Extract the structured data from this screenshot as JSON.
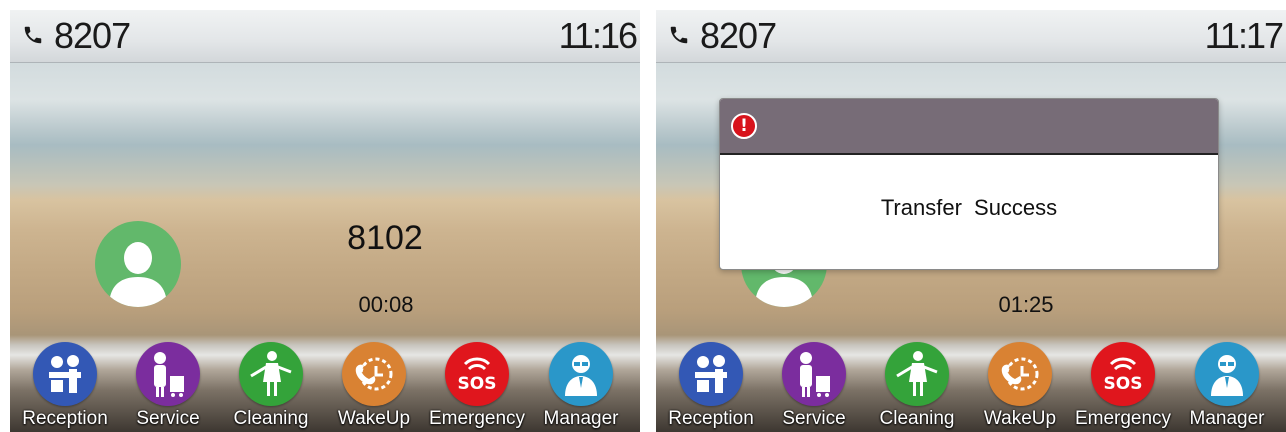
{
  "left_screen": {
    "status_bar": {
      "extension": "8207",
      "time": "11:16"
    },
    "call": {
      "caller_number": "8102",
      "duration": "00:08"
    }
  },
  "right_screen": {
    "status_bar": {
      "extension": "8207",
      "time": "11:17"
    },
    "call": {
      "duration": "01:25"
    },
    "dialog": {
      "message": "Transfer  Success",
      "icon": "alert-icon"
    }
  },
  "dock": [
    {
      "label": "Reception",
      "icon": "reception-icon",
      "color": "#3358b5"
    },
    {
      "label": "Service",
      "icon": "service-icon",
      "color": "#7b2d9e"
    },
    {
      "label": "Cleaning",
      "icon": "cleaning-icon",
      "color": "#34a33a"
    },
    {
      "label": "WakeUp",
      "icon": "wakeup-icon",
      "color": "#d98233"
    },
    {
      "label": "Emergency",
      "icon": "emergency-icon",
      "color": "#e0161d"
    },
    {
      "label": "Manager",
      "icon": "manager-icon",
      "color": "#2a97c9"
    }
  ]
}
